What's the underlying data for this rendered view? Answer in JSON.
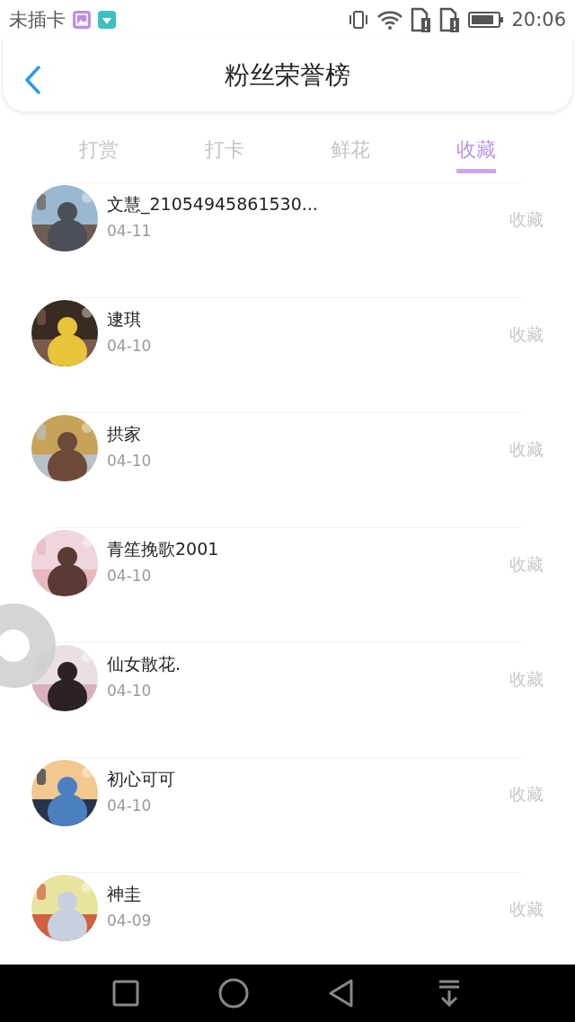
{
  "status_bar": {
    "carrier": "未插卡",
    "time": "20:06"
  },
  "header": {
    "title": "粉丝荣誉榜"
  },
  "tabs": [
    {
      "label": "打赏",
      "selected": false
    },
    {
      "label": "打卡",
      "selected": false
    },
    {
      "label": "鲜花",
      "selected": false
    },
    {
      "label": "收藏",
      "selected": true
    }
  ],
  "fans": [
    {
      "name": "文慧_21054945861530...",
      "date": "04-11",
      "action": "收藏"
    },
    {
      "name": "逮琪",
      "date": "04-10",
      "action": "收藏"
    },
    {
      "name": "拱家",
      "date": "04-10",
      "action": "收藏"
    },
    {
      "name": "青笙挽歌2001",
      "date": "04-10",
      "action": "收藏"
    },
    {
      "name": "仙女散花.",
      "date": "04-10",
      "action": "收藏"
    },
    {
      "name": "初心可可",
      "date": "04-10",
      "action": "收藏"
    },
    {
      "name": "神圭",
      "date": "04-09",
      "action": "收藏"
    }
  ]
}
